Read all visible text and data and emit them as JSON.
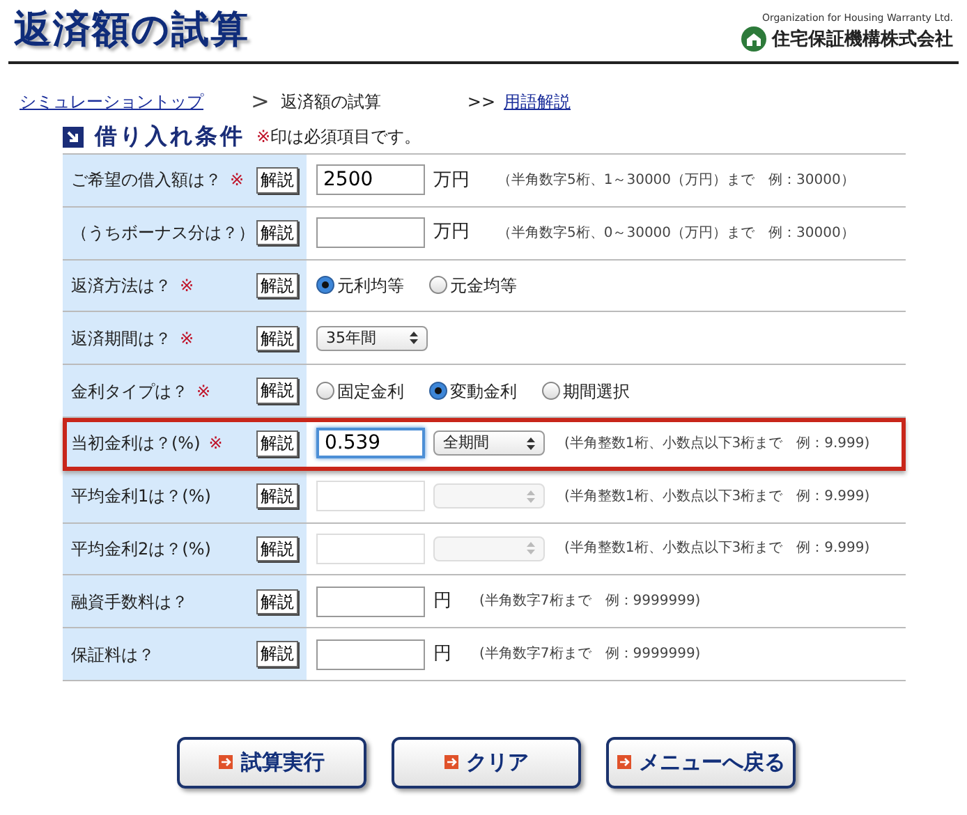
{
  "header": {
    "title": "返済額の試算",
    "org_en": "Organization for Housing Warranty Ltd.",
    "org_name": "住宅保証機構株式会社"
  },
  "breadcrumb": {
    "top_link": "シミュレーショントップ",
    "separator": ">",
    "current": "返済額の試算",
    "glossary_prefix": ">>",
    "glossary_link": "用語解説"
  },
  "section": {
    "title": "借り入れ条件",
    "note_mark": "※",
    "note": "印は必須項目です。"
  },
  "rows": [
    {
      "label": "ご希望の借入額は？",
      "mark": "※",
      "help": "解説",
      "kind": "text",
      "highlighted": false,
      "field": {
        "value": "2500",
        "disabled": false,
        "focused": false
      },
      "unit": "万円",
      "hint": "（半角数字5桁、1～30000（万円）まで　例：30000）"
    },
    {
      "label": "（うちボーナス分は？）",
      "help": "解説",
      "kind": "text",
      "highlighted": false,
      "field": {
        "disabled": false,
        "focused": false
      },
      "unit": "万円",
      "hint": "（半角数字5桁、0～30000（万円）まで　例：30000）"
    },
    {
      "label": "返済方法は？",
      "mark": "※",
      "help": "解説",
      "kind": "radio",
      "highlighted": false,
      "options": [
        {
          "label": "元利均等",
          "selected": true
        },
        {
          "label": "元金均等",
          "selected": false
        }
      ]
    },
    {
      "label": "返済期間は？",
      "mark": "※",
      "help": "解説",
      "kind": "select",
      "highlighted": false,
      "select": {
        "value": "35年間",
        "disabled": false
      }
    },
    {
      "label": "金利タイプは？",
      "mark": "※",
      "help": "解説",
      "kind": "radio",
      "highlighted": false,
      "options": [
        {
          "label": "固定金利",
          "selected": false
        },
        {
          "label": "変動金利",
          "selected": true
        },
        {
          "label": "期間選択",
          "selected": false
        }
      ]
    },
    {
      "label": "当初金利は？(%)",
      "mark": "※",
      "help": "解説",
      "kind": "rate",
      "highlighted": true,
      "field": {
        "value": "0.539",
        "disabled": false,
        "focused": true
      },
      "select": {
        "value": "全期間",
        "disabled": false
      },
      "hint": "(半角整数1桁、小数点以下3桁まで　例：9.999)"
    },
    {
      "label": "平均金利1は？(%)",
      "help": "解説",
      "kind": "rate",
      "highlighted": false,
      "field": {
        "disabled": true,
        "focused": false
      },
      "select": {
        "disabled": true
      },
      "hint": "(半角整数1桁、小数点以下3桁まで　例：9.999)"
    },
    {
      "label": "平均金利2は？(%)",
      "help": "解説",
      "kind": "rate",
      "highlighted": false,
      "field": {
        "disabled": true,
        "focused": false
      },
      "select": {
        "disabled": true
      },
      "hint": "(半角整数1桁、小数点以下3桁まで　例：9.999)"
    },
    {
      "label": "融資手数料は？",
      "help": "解説",
      "kind": "text",
      "highlighted": false,
      "field": {
        "disabled": false,
        "focused": false
      },
      "unit": "円",
      "hint": "(半角数字7桁まで　例：9999999)"
    },
    {
      "label": "保証料は？",
      "help": "解説",
      "kind": "text",
      "highlighted": false,
      "field": {
        "disabled": false,
        "focused": false
      },
      "unit": "円",
      "hint": "(半角数字7桁まで　例：9999999)"
    }
  ],
  "buttons": [
    {
      "label": "試算実行"
    },
    {
      "label": "クリア"
    },
    {
      "label": "メニューへ戻る"
    }
  ]
}
